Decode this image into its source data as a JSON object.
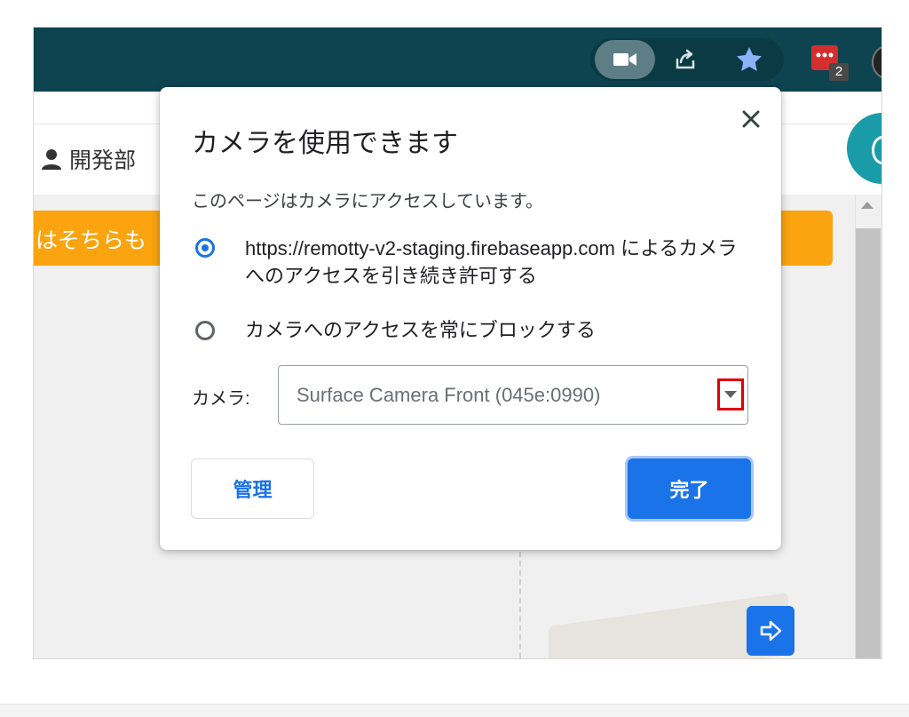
{
  "page": {
    "department": "開発部",
    "banner_text": "はそちらも"
  },
  "toolbar": {
    "extension_badge": "2",
    "icons": [
      "camera-icon",
      "share-icon",
      "bookmark-star-icon",
      "extension-icon",
      "profile-avatar"
    ]
  },
  "popup": {
    "title": "カメラを使用できます",
    "description": "このページはカメラにアクセスしています。",
    "options": [
      {
        "label": "https://remotty-v2-staging.firebaseapp.com によるカメラへのアクセスを引き続き許可する",
        "selected": true
      },
      {
        "label": "カメラへのアクセスを常にブロックする",
        "selected": false
      }
    ],
    "camera_label": "カメラ:",
    "camera_value": "Surface Camera Front (045e:0990)",
    "manage_label": "管理",
    "done_label": "完了"
  },
  "colors": {
    "toolbar_bg": "#0e4450",
    "accent": "#1a73e8",
    "banner": "#fba40f",
    "highlight_box": "#e00000"
  }
}
